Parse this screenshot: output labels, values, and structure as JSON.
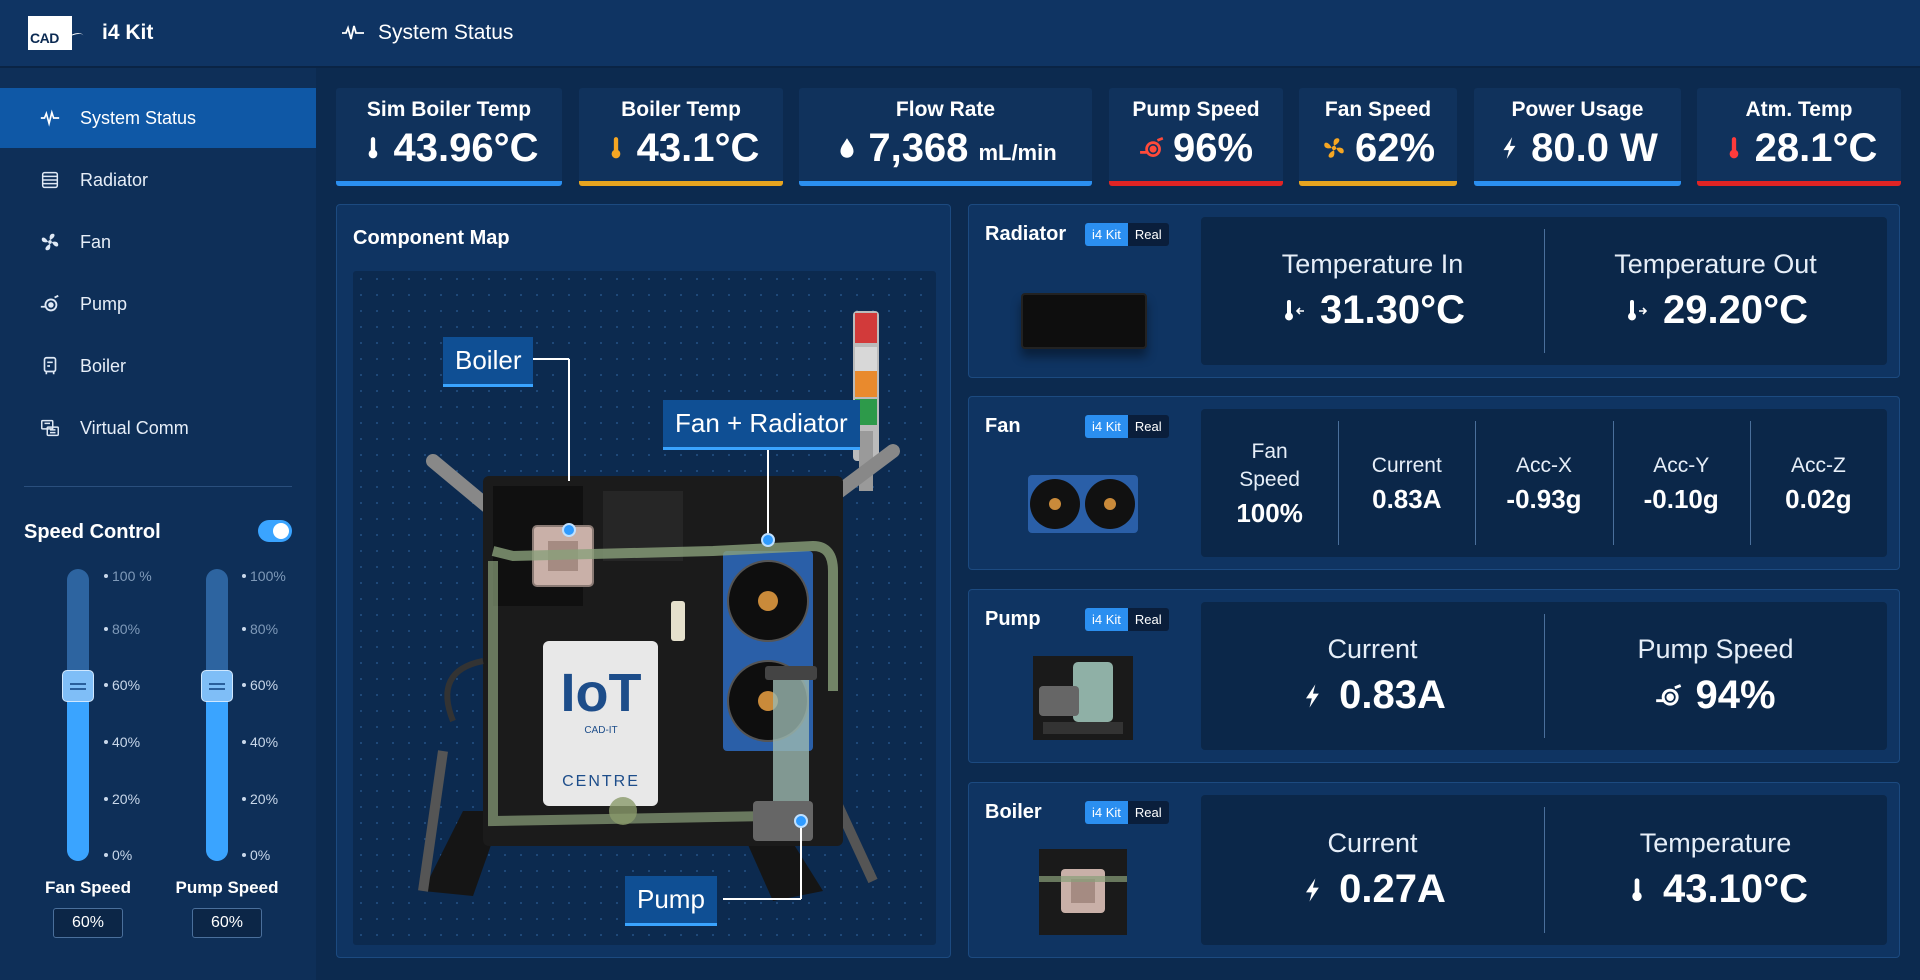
{
  "app": {
    "logo_text": "CAD",
    "title": "i4 Kit"
  },
  "header": {
    "title": "System Status"
  },
  "sidebar": {
    "items": [
      {
        "label": "System Status",
        "icon": "pulse-icon",
        "active": true
      },
      {
        "label": "Radiator",
        "icon": "radiator-icon"
      },
      {
        "label": "Fan",
        "icon": "fan-icon"
      },
      {
        "label": "Pump",
        "icon": "pump-icon"
      },
      {
        "label": "Boiler",
        "icon": "boiler-icon"
      },
      {
        "label": "Virtual Comm",
        "icon": "virtual-comm-icon"
      }
    ]
  },
  "speed_control": {
    "title": "Speed Control",
    "enabled": true,
    "fan": {
      "label": "Fan Speed",
      "value_text": "60%",
      "level": 0.6,
      "ticks": [
        "100 %",
        "80%",
        "60%",
        "40%",
        "20%",
        "0%"
      ]
    },
    "pump": {
      "label": "Pump Speed",
      "value_text": "60%",
      "level": 0.6,
      "ticks": [
        "100%",
        "80%",
        "60%",
        "40%",
        "20%",
        "0%"
      ]
    }
  },
  "kpis": [
    {
      "label": "Sim Boiler Temp",
      "value": "43.96°C",
      "unit": "",
      "icon": "thermometer-icon",
      "icon_color": "#ffffff",
      "bar_color": "#2b8ff0"
    },
    {
      "label": "Boiler Temp",
      "value": "43.1°C",
      "unit": "",
      "icon": "thermometer-icon",
      "icon_color": "#f5a623",
      "bar_color": "#e7a41f"
    },
    {
      "label": "Flow Rate",
      "value": "7,368",
      "unit": "mL/min",
      "icon": "droplet-icon",
      "icon_color": "#ffffff",
      "bar_color": "#2b8ff0"
    },
    {
      "label": "Pump Speed",
      "value": "96%",
      "unit": "",
      "icon": "pump-icon",
      "icon_color": "#ff4a3a",
      "bar_color": "#e02424"
    },
    {
      "label": "Fan Speed",
      "value": "62%",
      "unit": "",
      "icon": "fan-icon",
      "icon_color": "#f5a623",
      "bar_color": "#e7a41f"
    },
    {
      "label": "Power Usage",
      "value": "80.0 W",
      "unit": "",
      "icon": "bolt-icon",
      "icon_color": "#ffffff",
      "bar_color": "#2b8ff0"
    },
    {
      "label": "Atm. Temp",
      "value": "28.1°C",
      "unit": "",
      "icon": "thermometer-icon",
      "icon_color": "#ff3b3b",
      "bar_color": "#e02424"
    }
  ],
  "component_map": {
    "title": "Component Map",
    "callouts": {
      "boiler": "Boiler",
      "fan_radiator": "Fan + Radiator",
      "pump": "Pump"
    },
    "panel_logo": {
      "top": "IoT",
      "small": "CAD-IT",
      "bottom": "CENTRE"
    }
  },
  "panels": {
    "badges": {
      "kit": "i4 Kit",
      "real": "Real"
    },
    "radiator": {
      "name": "Radiator",
      "metrics": [
        {
          "label": "Temperature In",
          "value": "31.30°C",
          "icon": "thermometer-in-icon"
        },
        {
          "label": "Temperature Out",
          "value": "29.20°C",
          "icon": "thermometer-out-icon"
        }
      ]
    },
    "fan": {
      "name": "Fan",
      "metrics": [
        {
          "label": "Fan Speed",
          "value": "100%"
        },
        {
          "label": "Current",
          "value": "0.83A"
        },
        {
          "label": "Acc-X",
          "value": "-0.93g"
        },
        {
          "label": "Acc-Y",
          "value": "-0.10g"
        },
        {
          "label": "Acc-Z",
          "value": "0.02g"
        }
      ]
    },
    "pump": {
      "name": "Pump",
      "metrics": [
        {
          "label": "Current",
          "value": "0.83A",
          "icon": "bolt-icon"
        },
        {
          "label": "Pump Speed",
          "value": "94%",
          "icon": "pump-icon"
        }
      ]
    },
    "boiler": {
      "name": "Boiler",
      "metrics": [
        {
          "label": "Current",
          "value": "0.27A",
          "icon": "bolt-icon"
        },
        {
          "label": "Temperature",
          "value": "43.10°C",
          "icon": "thermometer-icon"
        }
      ]
    }
  }
}
